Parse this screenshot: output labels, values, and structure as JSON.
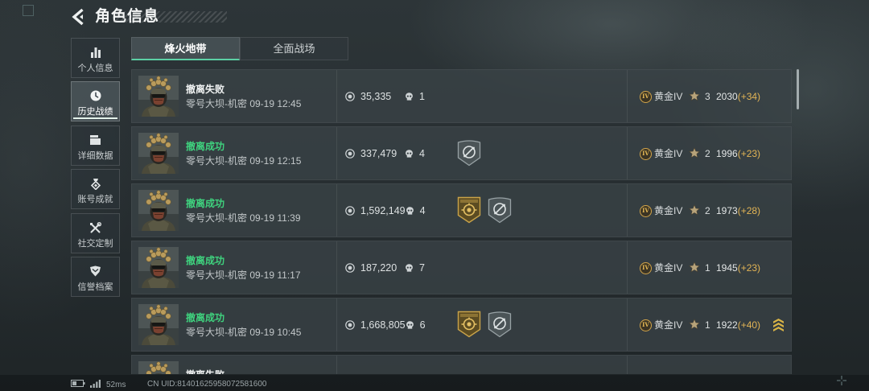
{
  "header": {
    "title": "角色信息"
  },
  "sidebar": {
    "items": [
      {
        "label": "个人信息",
        "icon": "bar-chart-icon",
        "selected": false
      },
      {
        "label": "历史战绩",
        "icon": "clock-icon",
        "selected": true
      },
      {
        "label": "详细数据",
        "icon": "folder-icon",
        "selected": false
      },
      {
        "label": "账号成就",
        "icon": "medal-icon",
        "selected": false
      },
      {
        "label": "社交定制",
        "icon": "tools-icon",
        "selected": false
      },
      {
        "label": "信誉档案",
        "icon": "shield-icon",
        "selected": false
      }
    ]
  },
  "tabs": [
    {
      "label": "烽火地带",
      "selected": true
    },
    {
      "label": "全面战场",
      "selected": false
    }
  ],
  "matches": [
    {
      "result": "撤离失败",
      "success": false,
      "subtitle": "零号大坝-机密 09-19 12:45",
      "value": "35,335",
      "kills": "1",
      "badges": [],
      "rank_badge": "IV",
      "rank": "黄金IV",
      "stars": "3",
      "score": "2030",
      "delta": "(+34)"
    },
    {
      "result": "撤离成功",
      "success": true,
      "subtitle": "零号大坝-机密 09-19 12:15",
      "value": "337,479",
      "kills": "4",
      "badges": [
        "silver-crosshair-badge-icon"
      ],
      "rank_badge": "IV",
      "rank": "黄金IV",
      "stars": "2",
      "score": "1996",
      "delta": "(+23)"
    },
    {
      "result": "撤离成功",
      "success": true,
      "subtitle": "零号大坝-机密 09-19 11:39",
      "value": "1,592,149",
      "kills": "4",
      "badges": [
        "gold-emblem-badge-icon",
        "silver-crosshair-badge-icon"
      ],
      "rank_badge": "IV",
      "rank": "黄金IV",
      "stars": "2",
      "score": "1973",
      "delta": "(+28)"
    },
    {
      "result": "撤离成功",
      "success": true,
      "subtitle": "零号大坝-机密 09-19 11:17",
      "value": "187,220",
      "kills": "7",
      "badges": [],
      "rank_badge": "IV",
      "rank": "黄金IV",
      "stars": "1",
      "score": "1945",
      "delta": "(+23)"
    },
    {
      "result": "撤离成功",
      "success": true,
      "subtitle": "零号大坝-机密 09-19 10:45",
      "value": "1,668,805",
      "kills": "6",
      "badges": [
        "gold-emblem-badge-icon",
        "silver-crosshair-badge-icon"
      ],
      "rank_badge": "IV",
      "rank": "黄金IV",
      "stars": "1",
      "score": "1922",
      "delta": "(+40)",
      "insignia": "rank-chevron-icon"
    },
    {
      "result": "撤离失败",
      "success": false
    }
  ],
  "status": {
    "ping": "52ms",
    "uid": "CN UID:81401625958072581600"
  },
  "colors": {
    "success": "#3fd27e",
    "failure": "#f1f3f3",
    "delta": "#e2b455",
    "tab_accent": "#5cd0a5",
    "rank_gold": "#d3a54a"
  }
}
